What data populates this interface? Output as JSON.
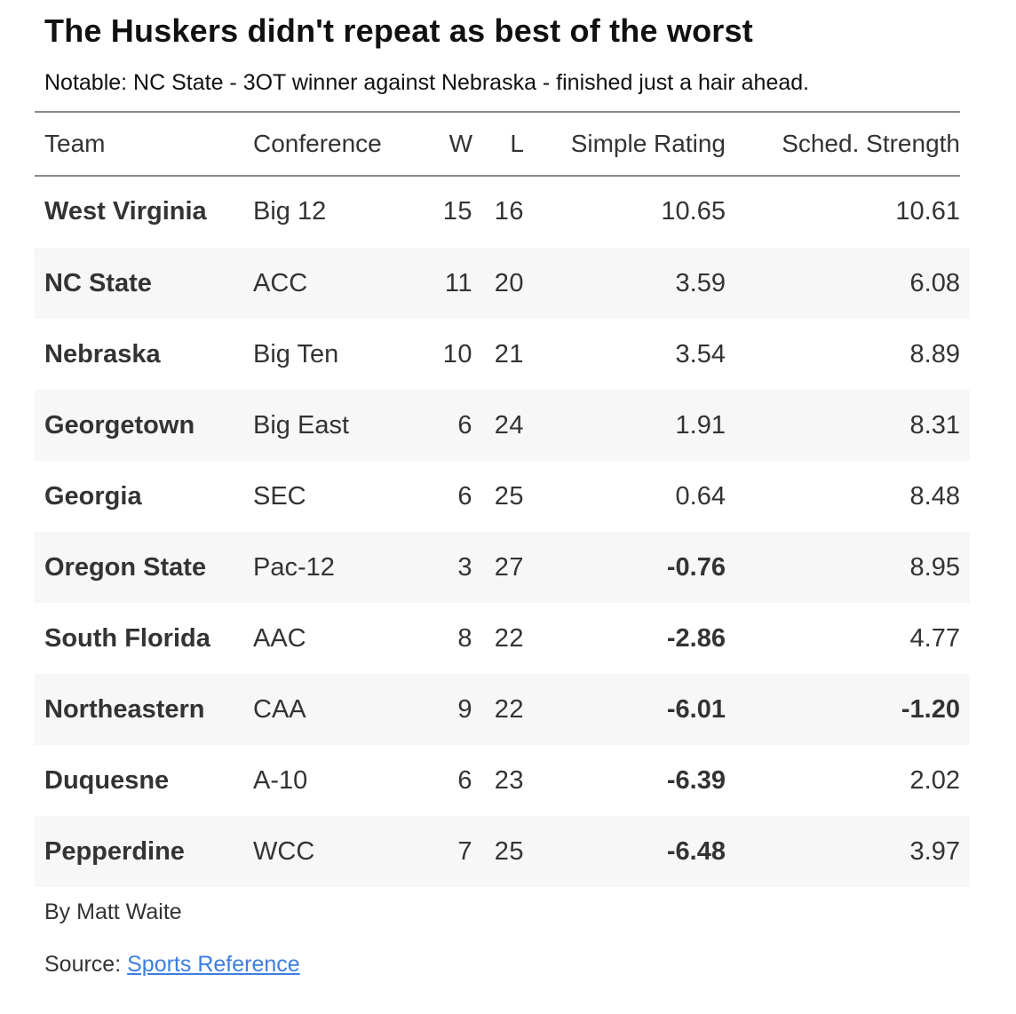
{
  "title": "The Huskers didn't repeat as best of the worst",
  "subtitle": "Notable: NC State - 3OT winner against Nebraska - finished just a hair ahead.",
  "columns": {
    "team": "Team",
    "conference": "Conference",
    "w": "W",
    "l": "L",
    "simple_rating": "Simple Rating",
    "sched_strength": "Sched. Strength"
  },
  "colors": {
    "positive": "#69ec59",
    "negative": "#e8342a",
    "link": "#3d7ee0"
  },
  "chart_data": {
    "type": "table",
    "columns": [
      "Team",
      "Conference",
      "W",
      "L",
      "Simple Rating",
      "Sched. Strength"
    ],
    "rows": [
      {
        "team": "West Virginia",
        "conference": "Big 12",
        "w": "15",
        "l": "16",
        "simple_rating": "10.65",
        "sched_strength": "10.61"
      },
      {
        "team": "NC State",
        "conference": "ACC",
        "w": "11",
        "l": "20",
        "simple_rating": "3.59",
        "sched_strength": "6.08"
      },
      {
        "team": "Nebraska",
        "conference": "Big Ten",
        "w": "10",
        "l": "21",
        "simple_rating": "3.54",
        "sched_strength": "8.89"
      },
      {
        "team": "Georgetown",
        "conference": "Big East",
        "w": "6",
        "l": "24",
        "simple_rating": "1.91",
        "sched_strength": "8.31"
      },
      {
        "team": "Georgia",
        "conference": "SEC",
        "w": "6",
        "l": "25",
        "simple_rating": "0.64",
        "sched_strength": "8.48"
      },
      {
        "team": "Oregon State",
        "conference": "Pac-12",
        "w": "3",
        "l": "27",
        "simple_rating": "-0.76",
        "sched_strength": "8.95"
      },
      {
        "team": "South Florida",
        "conference": "AAC",
        "w": "8",
        "l": "22",
        "simple_rating": "-2.86",
        "sched_strength": "4.77"
      },
      {
        "team": "Northeastern",
        "conference": "CAA",
        "w": "9",
        "l": "22",
        "simple_rating": "-6.01",
        "sched_strength": "-1.20"
      },
      {
        "team": "Duquesne",
        "conference": "A-10",
        "w": "6",
        "l": "23",
        "simple_rating": "-6.39",
        "sched_strength": "2.02"
      },
      {
        "team": "Pepperdine",
        "conference": "WCC",
        "w": "7",
        "l": "25",
        "simple_rating": "-6.48",
        "sched_strength": "3.97"
      }
    ]
  },
  "footer": {
    "byline": "By Matt Waite",
    "source_prefix": "Source:",
    "source_link": "Sports Reference"
  }
}
